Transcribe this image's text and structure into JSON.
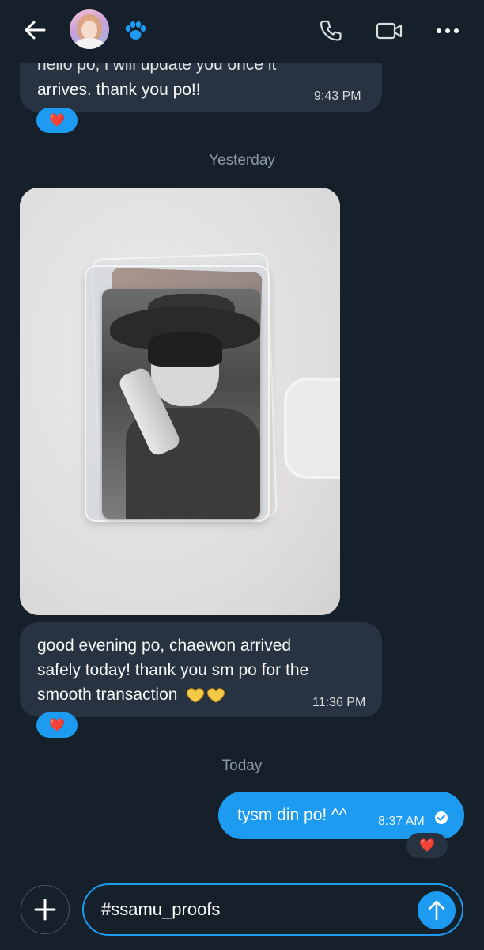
{
  "header": {
    "back_icon": "arrow-left-icon",
    "avatar_icon": "avatar",
    "badge_icon": "paw-icon",
    "call_icon": "phone-icon",
    "video_icon": "video-icon",
    "more_icon": "more-horizontal-icon"
  },
  "messages": [
    {
      "direction": "incoming",
      "cut_text": "hello po, i will update you once it",
      "text": "arrives. thank you po!!",
      "time": "9:43 PM",
      "reaction": "❤️"
    },
    {
      "direction": "incoming",
      "attachment": "photo"
    },
    {
      "direction": "incoming",
      "lines": [
        "good evening po, chaewon arrived",
        "safely today! thank you sm po for the",
        "smooth transaction"
      ],
      "time": "11:36 PM",
      "reaction": "❤️"
    },
    {
      "direction": "outgoing",
      "text": "tysm din po! ^^",
      "time": "8:37 AM",
      "reaction": "❤️"
    }
  ],
  "dividers": {
    "yesterday": "Yesterday",
    "today": "Today"
  },
  "composer": {
    "value": "#ssamu_proofs",
    "add_icon": "plus-icon",
    "send_icon": "send-arrow-icon"
  },
  "colors": {
    "background": "#15202b",
    "incoming_bubble": "#273340",
    "accent": "#1d9bf0",
    "muted_text": "#8b98a5",
    "heart": "#f4212e"
  }
}
